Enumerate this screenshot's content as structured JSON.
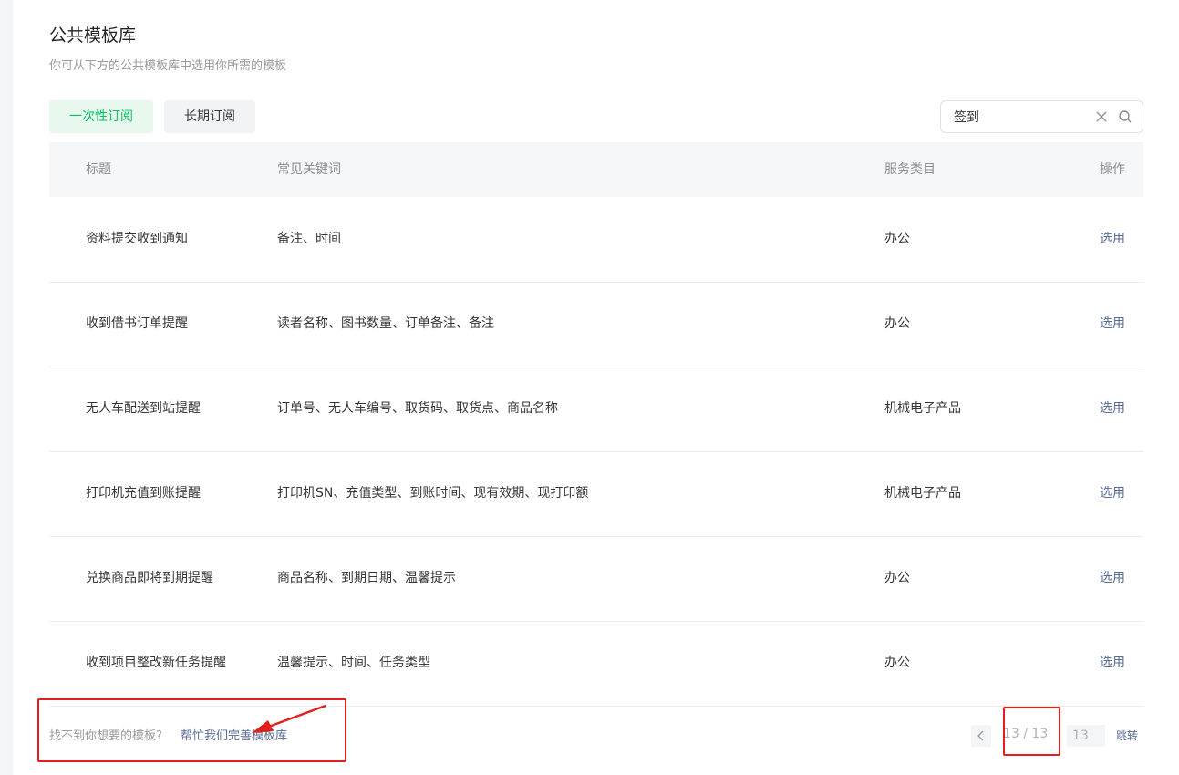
{
  "header": {
    "title": "公共模板库",
    "subtitle": "你可从下方的公共模板库中选用你所需的模板"
  },
  "tabs": [
    {
      "label": "一次性订阅",
      "active": true
    },
    {
      "label": "长期订阅",
      "active": false
    }
  ],
  "search": {
    "value": "签到",
    "placeholder": "",
    "clear_icon": "close-icon",
    "search_icon": "search-icon"
  },
  "table": {
    "columns": [
      "标题",
      "常见关键词",
      "服务类目",
      "操作"
    ],
    "rows": [
      {
        "title": "资料提交收到通知",
        "keywords": "备注、时间",
        "category": "办公",
        "action": "选用"
      },
      {
        "title": "收到借书订单提醒",
        "keywords": "读者名称、图书数量、订单备注、备注",
        "category": "办公",
        "action": "选用"
      },
      {
        "title": "无人车配送到站提醒",
        "keywords": "订单号、无人车编号、取货码、取货点、商品名称",
        "category": "机械电子产品",
        "action": "选用"
      },
      {
        "title": "打印机充值到账提醒",
        "keywords": "打印机SN、充值类型、到账时间、现有效期、现打印额",
        "category": "机械电子产品",
        "action": "选用"
      },
      {
        "title": "兑换商品即将到期提醒",
        "keywords": "商品名称、到期日期、温馨提示",
        "category": "办公",
        "action": "选用"
      },
      {
        "title": "收到项目整改新任务提醒",
        "keywords": "温馨提示、时间、任务类型",
        "category": "办公",
        "action": "选用"
      }
    ]
  },
  "footer": {
    "hint": "找不到你想要的模板?",
    "link": "帮忙我们完善模板库"
  },
  "pagination": {
    "count_text": "13 / 13",
    "input_value": "13",
    "jump_label": "跳转"
  },
  "colors": {
    "accent_green": "#07c160",
    "link_blue": "#576b95",
    "annotation_red": "#e0201c"
  }
}
